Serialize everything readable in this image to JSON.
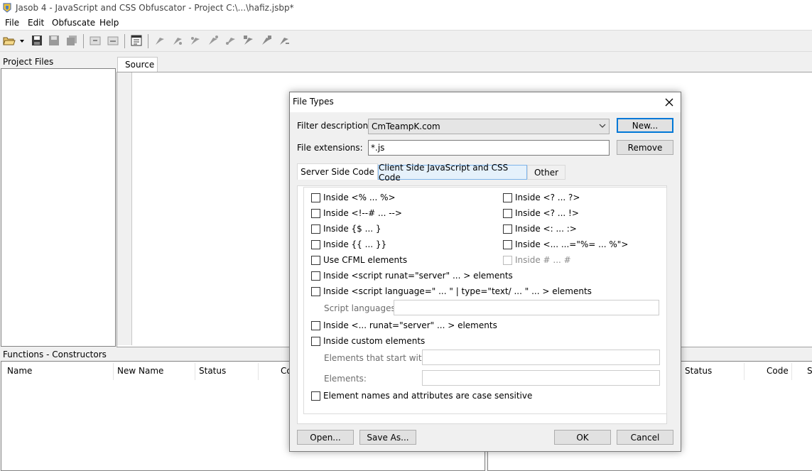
{
  "window": {
    "title": "Jasob 4 - JavaScript and CSS Obfuscator - Project  C:\\...\\hafiz.jsbp*"
  },
  "menu": [
    "File",
    "Edit",
    "Obfuscate",
    "Help"
  ],
  "left_panel": {
    "label": "Project Files"
  },
  "source_tab": {
    "label": "Source"
  },
  "functions_panel": {
    "label": "Functions - Constructors",
    "columns": [
      "Name",
      "New Name",
      "Status",
      "Co"
    ]
  },
  "right_panel": {
    "columns": [
      "Status",
      "Code",
      "S"
    ]
  },
  "dialog": {
    "title": "File Types",
    "filter_label": "Filter description:",
    "filter_value": "CmTeampK.com",
    "extensions_label": "File extensions:",
    "extensions_value": "*.js",
    "new_button": "New...",
    "remove_button": "Remove",
    "tabs": [
      "Server Side Code",
      "Client Side JavaScript and CSS Code",
      "Other"
    ],
    "options_left": [
      "Inside <% ... %>",
      "Inside <!--# ... -->",
      "Inside {$ ... }",
      "Inside {{ ... }}",
      "Use CFML elements",
      "Inside <script runat=\"server\" ... > elements",
      "Inside <script language=\" ... \" | type=\"text/ ... \" ... > elements"
    ],
    "options_right": [
      "Inside <? ... ?>",
      "Inside <? ... !>",
      "Inside <: ... :>",
      "Inside <... ...=\"%= ... %\">",
      "Inside # ... #"
    ],
    "script_languages_label": "Script languages:",
    "option_runat": "Inside <... runat=\"server\" ... > elements",
    "option_custom": "Inside custom elements",
    "elements_start_label": "Elements that start with:",
    "elements_label": "Elements:",
    "option_case": "Element names and attributes are case sensitive",
    "open_button": "Open...",
    "save_as_button": "Save As...",
    "ok_button": "OK",
    "cancel_button": "Cancel"
  }
}
